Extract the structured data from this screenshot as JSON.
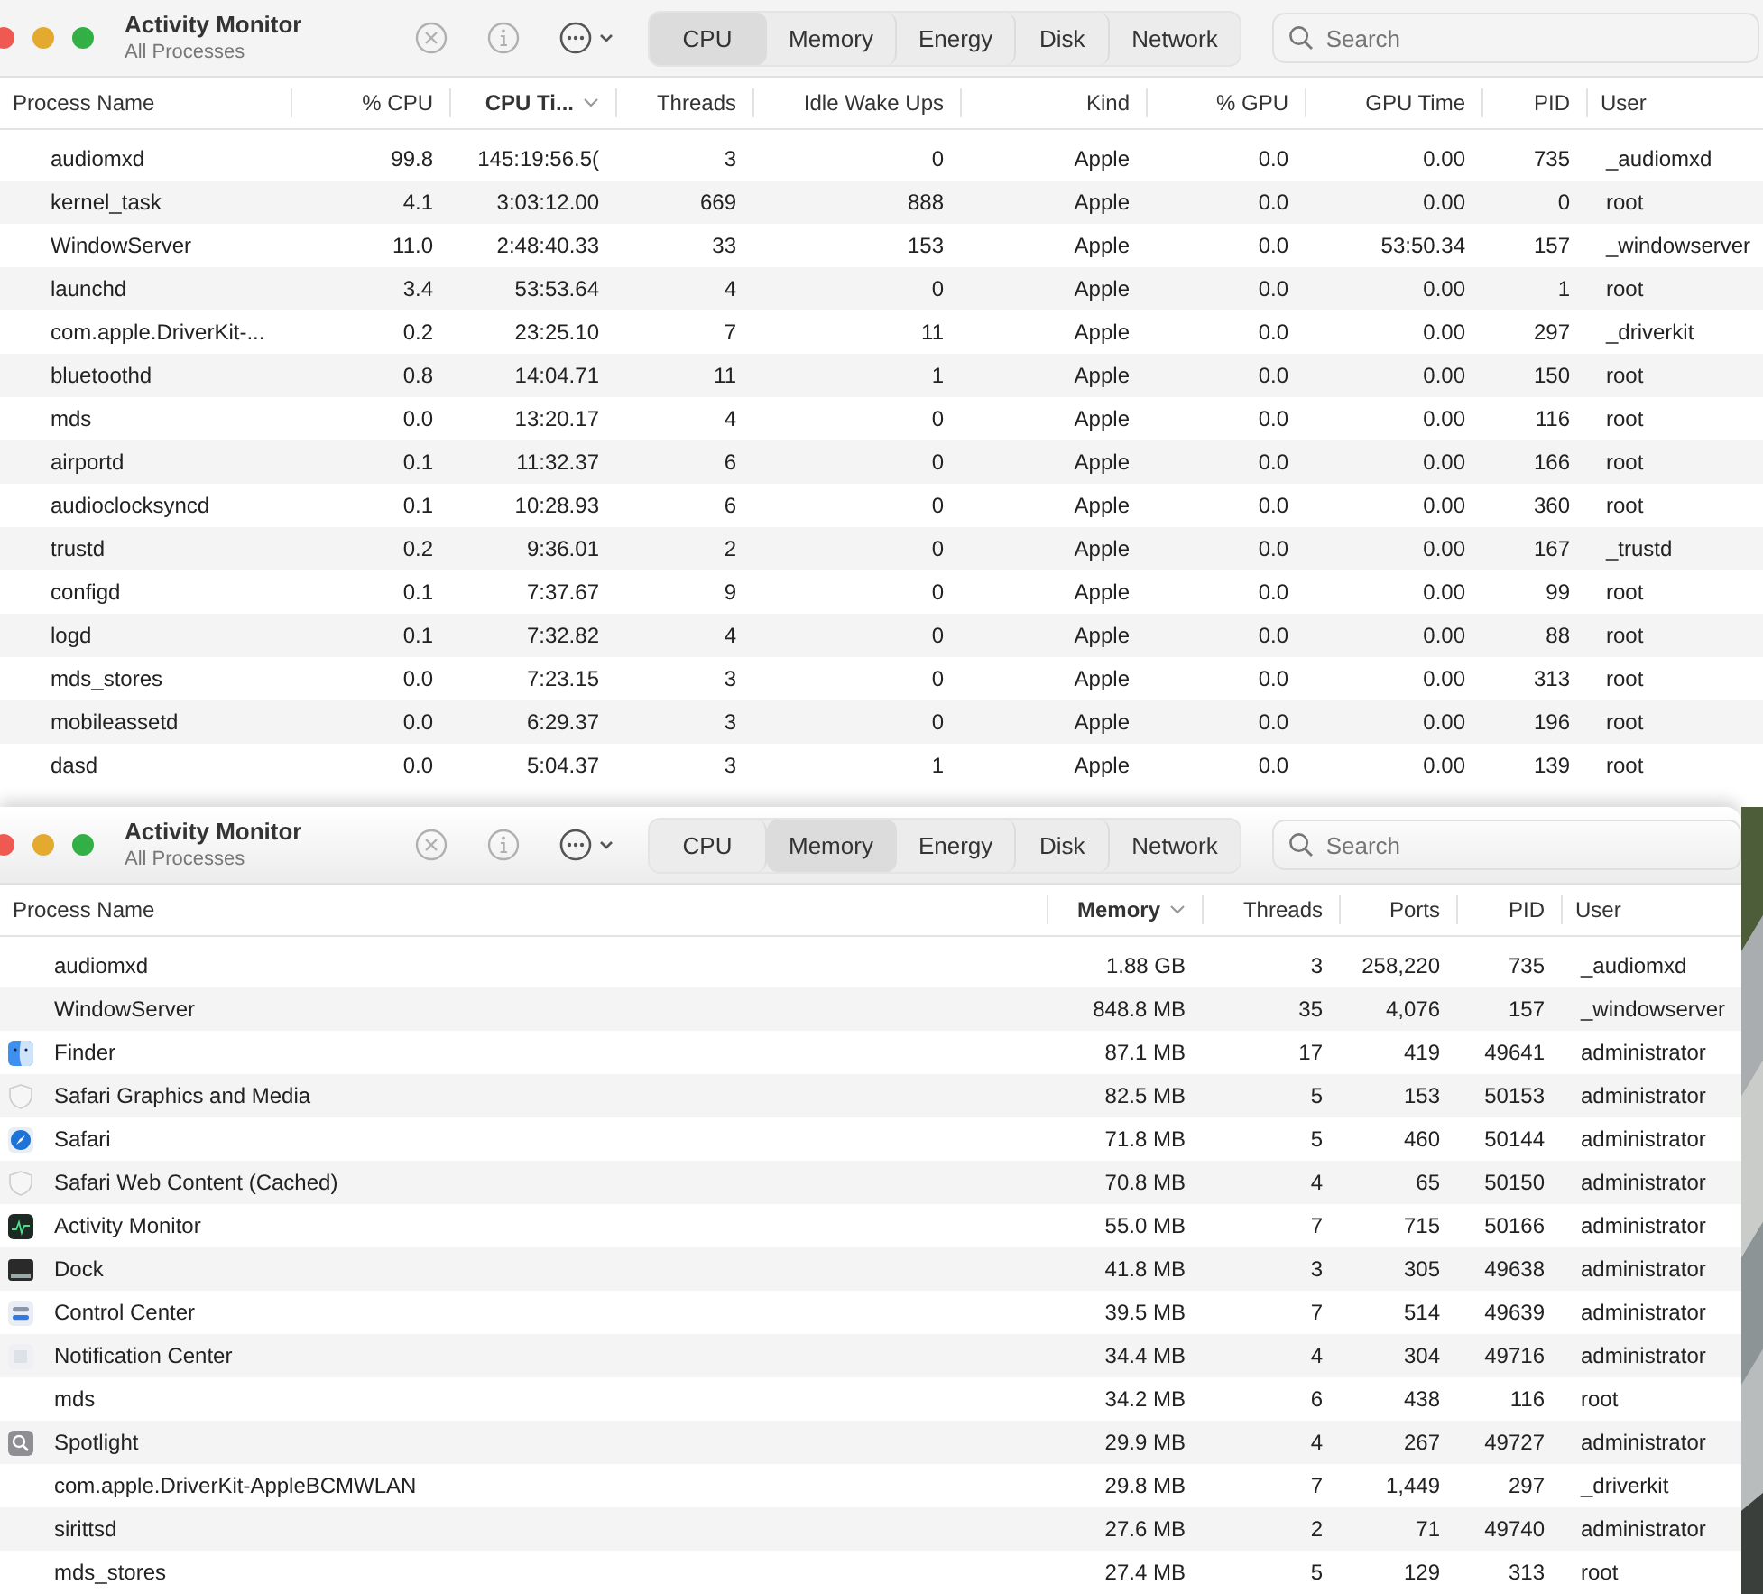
{
  "windows": [
    {
      "title": "Activity Monitor",
      "subtitle": "All Processes",
      "tabs": [
        {
          "label": "CPU",
          "selected": true
        },
        {
          "label": "Memory",
          "selected": false
        },
        {
          "label": "Energy",
          "selected": false
        },
        {
          "label": "Disk",
          "selected": false
        },
        {
          "label": "Network",
          "selected": false
        }
      ],
      "search": {
        "placeholder": "Search"
      },
      "columns": [
        {
          "label": "Process Name",
          "sorted": false
        },
        {
          "label": "% CPU",
          "sorted": false
        },
        {
          "label": "CPU Ti...",
          "sorted": true
        },
        {
          "label": "Threads",
          "sorted": false
        },
        {
          "label": "Idle Wake Ups",
          "sorted": false
        },
        {
          "label": "Kind",
          "sorted": false
        },
        {
          "label": "% GPU",
          "sorted": false
        },
        {
          "label": "GPU Time",
          "sorted": false
        },
        {
          "label": "PID",
          "sorted": false
        },
        {
          "label": "User",
          "sorted": false
        }
      ],
      "rows": [
        {
          "cells": [
            "audiomxd",
            "99.8",
            "145:19:56.5(",
            "3",
            "0",
            "Apple",
            "0.0",
            "0.00",
            "735",
            "_audiomxd"
          ]
        },
        {
          "cells": [
            "kernel_task",
            "4.1",
            "3:03:12.00",
            "669",
            "888",
            "Apple",
            "0.0",
            "0.00",
            "0",
            "root"
          ]
        },
        {
          "cells": [
            "WindowServer",
            "11.0",
            "2:48:40.33",
            "33",
            "153",
            "Apple",
            "0.0",
            "53:50.34",
            "157",
            "_windowserver"
          ]
        },
        {
          "cells": [
            "launchd",
            "3.4",
            "53:53.64",
            "4",
            "0",
            "Apple",
            "0.0",
            "0.00",
            "1",
            "root"
          ]
        },
        {
          "cells": [
            "com.apple.DriverKit-...",
            "0.2",
            "23:25.10",
            "7",
            "11",
            "Apple",
            "0.0",
            "0.00",
            "297",
            "_driverkit"
          ]
        },
        {
          "cells": [
            "bluetoothd",
            "0.8",
            "14:04.71",
            "11",
            "1",
            "Apple",
            "0.0",
            "0.00",
            "150",
            "root"
          ]
        },
        {
          "cells": [
            "mds",
            "0.0",
            "13:20.17",
            "4",
            "0",
            "Apple",
            "0.0",
            "0.00",
            "116",
            "root"
          ]
        },
        {
          "cells": [
            "airportd",
            "0.1",
            "11:32.37",
            "6",
            "0",
            "Apple",
            "0.0",
            "0.00",
            "166",
            "root"
          ]
        },
        {
          "cells": [
            "audioclocksyncd",
            "0.1",
            "10:28.93",
            "6",
            "0",
            "Apple",
            "0.0",
            "0.00",
            "360",
            "root"
          ]
        },
        {
          "cells": [
            "trustd",
            "0.2",
            "9:36.01",
            "2",
            "0",
            "Apple",
            "0.0",
            "0.00",
            "167",
            "_trustd"
          ]
        },
        {
          "cells": [
            "configd",
            "0.1",
            "7:37.67",
            "9",
            "0",
            "Apple",
            "0.0",
            "0.00",
            "99",
            "root"
          ]
        },
        {
          "cells": [
            "logd",
            "0.1",
            "7:32.82",
            "4",
            "0",
            "Apple",
            "0.0",
            "0.00",
            "88",
            "root"
          ]
        },
        {
          "cells": [
            "mds_stores",
            "0.0",
            "7:23.15",
            "3",
            "0",
            "Apple",
            "0.0",
            "0.00",
            "313",
            "root"
          ]
        },
        {
          "cells": [
            "mobileassetd",
            "0.0",
            "6:29.37",
            "3",
            "0",
            "Apple",
            "0.0",
            "0.00",
            "196",
            "root"
          ]
        },
        {
          "cells": [
            "dasd",
            "0.0",
            "5:04.37",
            "3",
            "1",
            "Apple",
            "0.0",
            "0.00",
            "139",
            "root"
          ]
        }
      ]
    },
    {
      "title": "Activity Monitor",
      "subtitle": "All Processes",
      "tabs": [
        {
          "label": "CPU",
          "selected": false
        },
        {
          "label": "Memory",
          "selected": true
        },
        {
          "label": "Energy",
          "selected": false
        },
        {
          "label": "Disk",
          "selected": false
        },
        {
          "label": "Network",
          "selected": false
        }
      ],
      "search": {
        "placeholder": "Search"
      },
      "columns": [
        {
          "label": "Process Name",
          "sorted": false
        },
        {
          "label": "Memory",
          "sorted": true
        },
        {
          "label": "Threads",
          "sorted": false
        },
        {
          "label": "Ports",
          "sorted": false
        },
        {
          "label": "PID",
          "sorted": false
        },
        {
          "label": "User",
          "sorted": false
        }
      ],
      "rows": [
        {
          "cells": [
            "audiomxd",
            "1.88 GB",
            "3",
            "258,220",
            "735",
            "_audiomxd"
          ]
        },
        {
          "cells": [
            "WindowServer",
            "848.8 MB",
            "35",
            "4,076",
            "157",
            "_windowserver"
          ]
        },
        {
          "kind": "finder",
          "cells": [
            "Finder",
            "87.1 MB",
            "17",
            "419",
            "49641",
            "administrator"
          ]
        },
        {
          "kind": "shield",
          "cells": [
            "Safari Graphics and Media",
            "82.5 MB",
            "5",
            "153",
            "50153",
            "administrator"
          ]
        },
        {
          "kind": "compass",
          "cells": [
            "Safari",
            "71.8 MB",
            "5",
            "460",
            "50144",
            "administrator"
          ]
        },
        {
          "kind": "shield",
          "cells": [
            "Safari Web Content (Cached)",
            "70.8 MB",
            "4",
            "65",
            "50150",
            "administrator"
          ]
        },
        {
          "kind": "monitor",
          "cells": [
            "Activity Monitor",
            "55.0 MB",
            "7",
            "715",
            "50166",
            "administrator"
          ]
        },
        {
          "kind": "dock",
          "cells": [
            "Dock",
            "41.8 MB",
            "3",
            "305",
            "49638",
            "administrator"
          ]
        },
        {
          "kind": "toggles",
          "cells": [
            "Control Center",
            "39.5 MB",
            "7",
            "514",
            "49639",
            "administrator"
          ]
        },
        {
          "kind": "grid",
          "cells": [
            "Notification Center",
            "34.4 MB",
            "4",
            "304",
            "49716",
            "administrator"
          ]
        },
        {
          "cells": [
            "mds",
            "34.2 MB",
            "6",
            "438",
            "116",
            "root"
          ]
        },
        {
          "kind": "magnifier",
          "cells": [
            "Spotlight",
            "29.9 MB",
            "4",
            "267",
            "49727",
            "administrator"
          ]
        },
        {
          "cells": [
            "com.apple.DriverKit-AppleBCMWLAN",
            "29.8 MB",
            "7",
            "1,449",
            "297",
            "_driverkit"
          ]
        },
        {
          "cells": [
            "sirittsd",
            "27.6 MB",
            "2",
            "71",
            "49740",
            "administrator"
          ]
        },
        {
          "cells": [
            "mds_stores",
            "27.4 MB",
            "5",
            "129",
            "313",
            "root"
          ]
        }
      ]
    }
  ]
}
